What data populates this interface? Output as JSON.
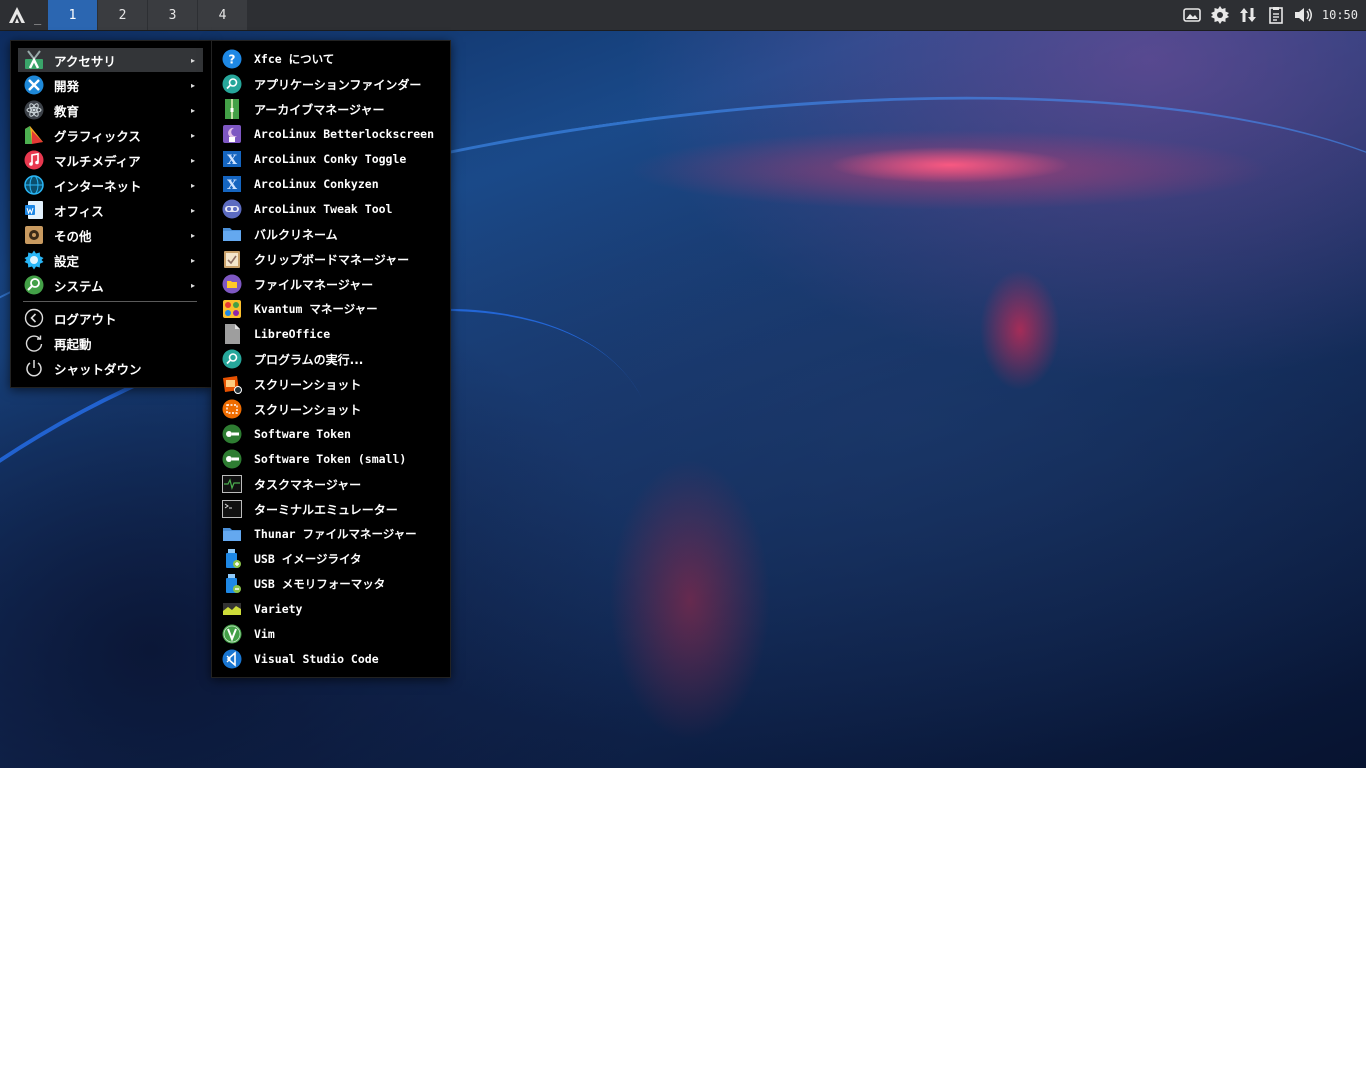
{
  "panel": {
    "workspaces": [
      "1",
      "2",
      "3",
      "4"
    ],
    "active_workspace": "1",
    "clock": "10:50",
    "tray_icons": [
      "screenshot-icon",
      "settings-icon",
      "network-icon",
      "clipboard-icon",
      "volume-icon"
    ]
  },
  "main_menu": {
    "categories": [
      {
        "label": "アクセサリ",
        "icon": "accessories-icon"
      },
      {
        "label": "開発",
        "icon": "development-icon"
      },
      {
        "label": "教育",
        "icon": "education-icon"
      },
      {
        "label": "グラフィックス",
        "icon": "graphics-icon"
      },
      {
        "label": "マルチメディア",
        "icon": "multimedia-icon"
      },
      {
        "label": "インターネット",
        "icon": "internet-icon"
      },
      {
        "label": "オフィス",
        "icon": "office-icon"
      },
      {
        "label": "その他",
        "icon": "other-icon"
      },
      {
        "label": "設定",
        "icon": "settings-icon"
      },
      {
        "label": "システム",
        "icon": "system-icon"
      }
    ],
    "actions": [
      {
        "label": "ログアウト",
        "icon": "logout-icon"
      },
      {
        "label": "再起動",
        "icon": "restart-icon"
      },
      {
        "label": "シャットダウン",
        "icon": "shutdown-icon"
      }
    ],
    "arrow": "▸"
  },
  "accessories_menu": {
    "items": [
      {
        "label": "Xfce について"
      },
      {
        "label": "アプリケーションファインダー"
      },
      {
        "label": "アーカイブマネージャー"
      },
      {
        "label": "ArcoLinux Betterlockscreen"
      },
      {
        "label": "ArcoLinux Conky Toggle"
      },
      {
        "label": "ArcoLinux Conkyzen"
      },
      {
        "label": "ArcoLinux Tweak Tool"
      },
      {
        "label": "バルクリネーム"
      },
      {
        "label": "クリップボードマネージャー"
      },
      {
        "label": "ファイルマネージャー"
      },
      {
        "label": "Kvantum マネージャー"
      },
      {
        "label": "LibreOffice"
      },
      {
        "label": "プログラムの実行..."
      },
      {
        "label": "スクリーンショット"
      },
      {
        "label": "スクリーンショット"
      },
      {
        "label": "Software Token"
      },
      {
        "label": "Software Token (small)"
      },
      {
        "label": "タスクマネージャー"
      },
      {
        "label": "ターミナルエミュレーター"
      },
      {
        "label": "Thunar ファイルマネージャー"
      },
      {
        "label": "USB イメージライタ"
      },
      {
        "label": "USB メモリフォーマッタ"
      },
      {
        "label": "Variety"
      },
      {
        "label": "Vim"
      },
      {
        "label": "Visual Studio Code"
      }
    ]
  }
}
